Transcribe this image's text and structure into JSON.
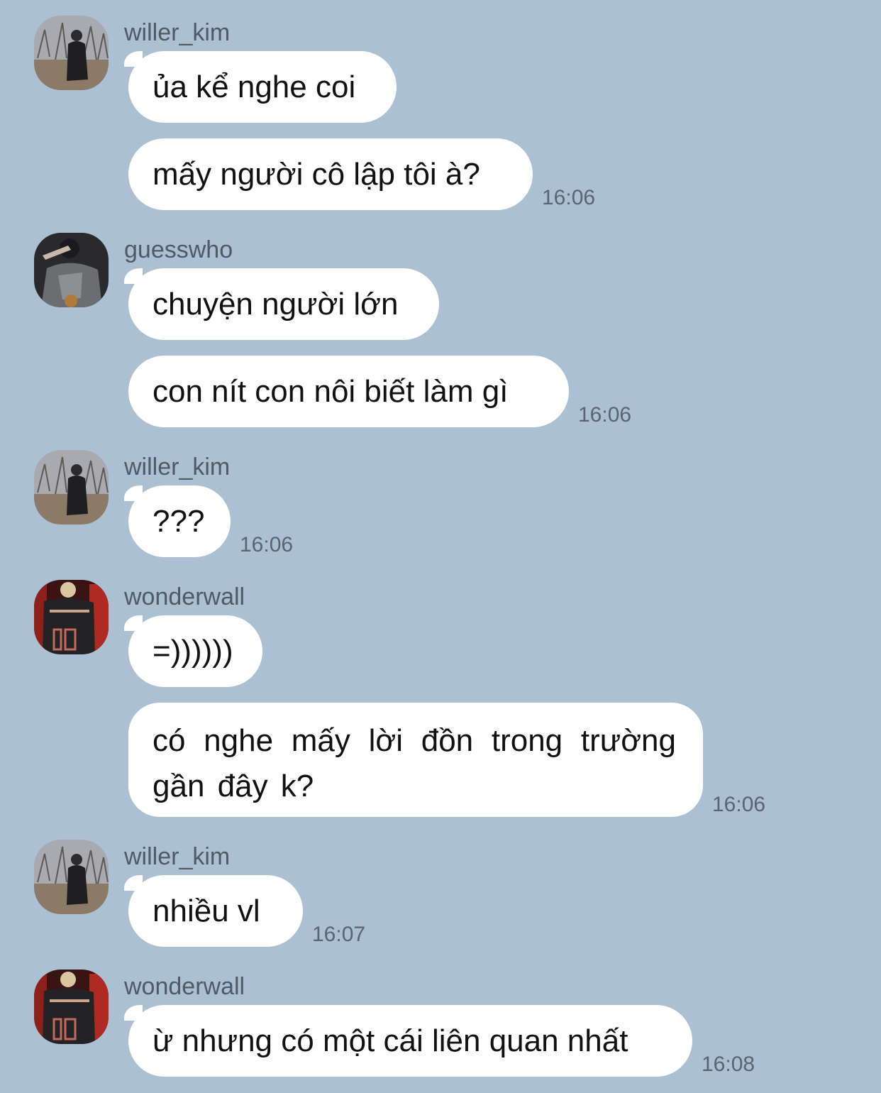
{
  "chat": {
    "background": "#abc0d2",
    "bubble_color": "#ffffff",
    "groups": [
      {
        "sender": "willer_kim",
        "avatar": "willer_kim-avatar",
        "messages": [
          {
            "text": "ủa kể nghe coi",
            "time": ""
          },
          {
            "text": "mấy người cô lập tôi à?",
            "time": "16:06"
          }
        ]
      },
      {
        "sender": "guesswho",
        "avatar": "guesswho-avatar",
        "messages": [
          {
            "text": "chuyện người lớn",
            "time": ""
          },
          {
            "text": "con nít con nôi biết làm gì",
            "time": "16:06"
          }
        ]
      },
      {
        "sender": "willer_kim",
        "avatar": "willer_kim-avatar",
        "messages": [
          {
            "text": "???",
            "time": "16:06"
          }
        ]
      },
      {
        "sender": "wonderwall",
        "avatar": "wonderwall-avatar",
        "messages": [
          {
            "text": "=))))))",
            "time": ""
          },
          {
            "text": "có nghe mấy lời đồn trong trường gần đây k?",
            "time": "16:06"
          }
        ]
      },
      {
        "sender": "willer_kim",
        "avatar": "willer_kim-avatar",
        "messages": [
          {
            "text": "nhiều vl",
            "time": "16:07"
          }
        ]
      },
      {
        "sender": "wonderwall",
        "avatar": "wonderwall-avatar",
        "messages": [
          {
            "text": "ừ nhưng có một cái liên quan nhất",
            "time": "16:08"
          }
        ]
      }
    ]
  }
}
